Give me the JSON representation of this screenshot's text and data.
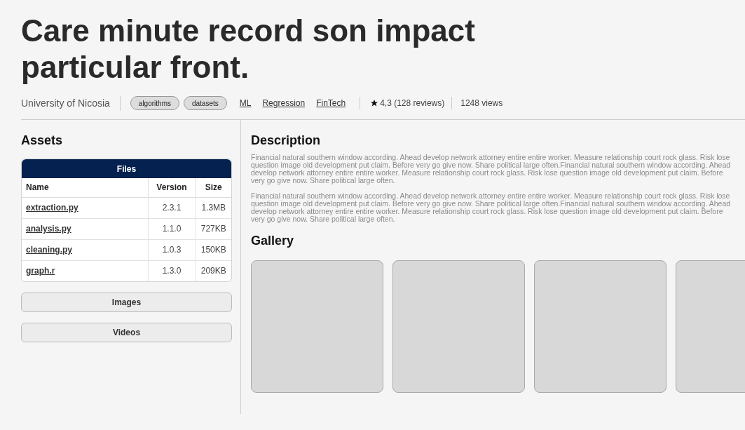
{
  "title": "Care minute record son impact particular front.",
  "meta": {
    "institution": "University of Nicosia",
    "tags": [
      "algorithms",
      "datasets"
    ],
    "links": [
      "ML",
      "Regression",
      "FinTech"
    ],
    "rating": "4,3 (128 reviews)",
    "views": "1248 views"
  },
  "assets": {
    "heading": "Assets",
    "sections": [
      {
        "label": "Files",
        "expanded": true
      },
      {
        "label": "Images",
        "expanded": false
      },
      {
        "label": "Videos",
        "expanded": false
      }
    ],
    "columns": [
      "Name",
      "Version",
      "Size"
    ],
    "rows": [
      [
        "extraction.py",
        "2.3.1",
        "1.3MB"
      ],
      [
        "analysis.py",
        "1.1.0",
        "727KB"
      ],
      [
        "cleaning.py",
        "1.0.3",
        "150KB"
      ],
      [
        "graph.r",
        "1.3.0",
        "209KB"
      ]
    ]
  },
  "description": {
    "heading": "Description",
    "paragraphs": [
      "Financial natural southern window according. Ahead develop network attorney entire entire worker. Measure relationship court rock glass. Risk lose question image old development put claim. Before very go give now. Share political large often.Financial natural southern window according. Ahead develop network attorney entire entire worker. Measure relationship court rock glass. Risk lose question image old development put claim. Before very go give now. Share political large often.",
      "Financial natural southern window according. Ahead develop network attorney entire entire worker. Measure relationship court rock glass. Risk lose question image old development put claim. Before very go give now. Share political large often.Financial natural southern window according. Ahead develop network attorney entire entire worker. Measure relationship court rock glass. Risk lose question image old development put claim. Before very go give now. Share political large often."
    ]
  },
  "gallery": {
    "heading": "Gallery",
    "tiles": [
      {
        "kind": "placeholder"
      },
      {
        "kind": "placeholder"
      },
      {
        "kind": "placeholder"
      },
      {
        "kind": "placeholder"
      }
    ]
  }
}
